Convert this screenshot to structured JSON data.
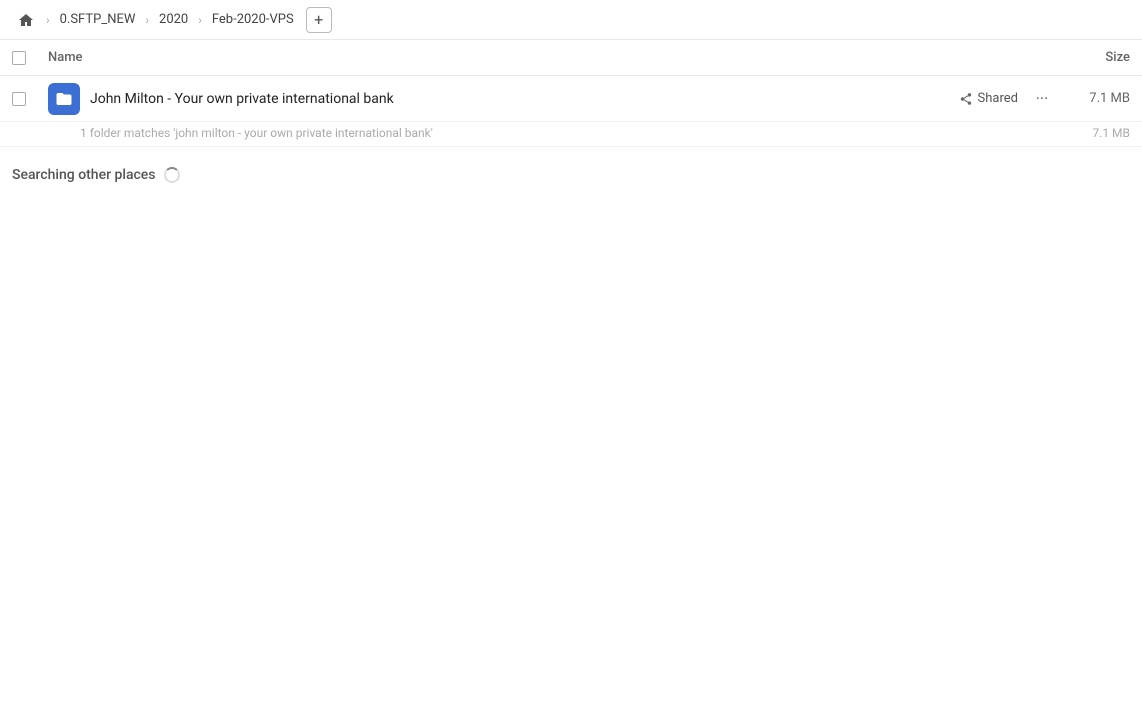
{
  "toolbar": {
    "home_icon": "home",
    "breadcrumbs": [
      {
        "label": "0.SFTP_NEW"
      },
      {
        "label": "2020"
      },
      {
        "label": "Feb-2020-VPS"
      }
    ],
    "add_button_label": "+"
  },
  "table": {
    "col_name": "Name",
    "col_size": "Size"
  },
  "file_row": {
    "icon_semantic": "folder-link-icon",
    "name": "John Milton - Your own private international bank",
    "shared_label": "Shared",
    "more_icon": "···",
    "size": "7.1 MB",
    "subtitle": "1 folder matches 'john milton - your own private international bank'",
    "subtitle_size": "7.1 MB"
  },
  "searching": {
    "label": "Searching other places",
    "spinner_semantic": "loading-spinner"
  }
}
